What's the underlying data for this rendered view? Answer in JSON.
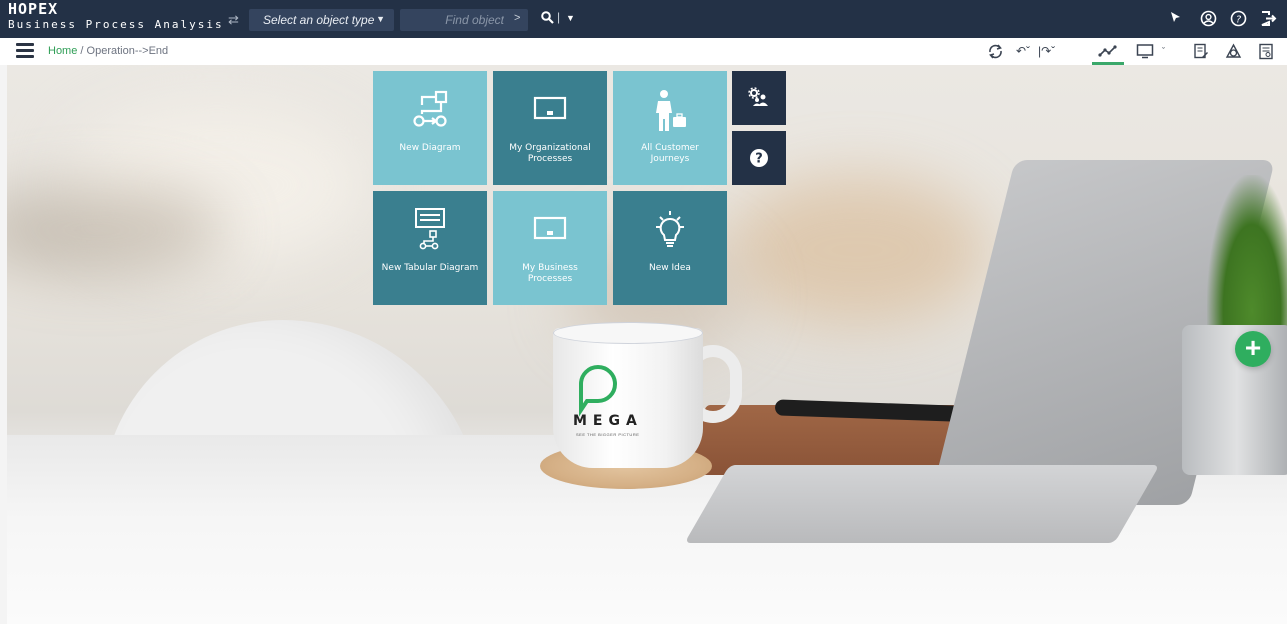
{
  "app": {
    "logo": "HOPEX",
    "product": "Business Process Analysis"
  },
  "search": {
    "object_type_label": "Select an object type",
    "find_placeholder": "Find object"
  },
  "breadcrumb": {
    "home": "Home",
    "separator": "/",
    "current": "Operation-->End"
  },
  "tiles": [
    {
      "label": "New Diagram",
      "icon": "diagram-flow-icon",
      "color": "#7ac4d0"
    },
    {
      "label": "My Organizational Processes",
      "icon": "monitor-icon",
      "color": "#3a7f8f"
    },
    {
      "label": "All Customer Journeys",
      "icon": "person-briefcase-icon",
      "color": "#7ac4d0"
    },
    {
      "label": "New Tabular Diagram",
      "icon": "tabular-diagram-icon",
      "color": "#3a7f8f"
    },
    {
      "label": "My Business Processes",
      "icon": "monitor-icon",
      "color": "#7ac4d0"
    },
    {
      "label": "New Idea",
      "icon": "lightbulb-icon",
      "color": "#3a7f8f"
    }
  ],
  "side_tiles": [
    {
      "icon": "settings-users-icon"
    },
    {
      "icon": "help-icon"
    }
  ],
  "mug": {
    "brand": "MEGA",
    "tagline": "SEE THE BIGGER PICTURE"
  },
  "colors": {
    "topbar": "#233146",
    "accent_green": "#2fae5f",
    "tile_light": "#7ac4d0",
    "tile_dark": "#3a7f8f"
  }
}
